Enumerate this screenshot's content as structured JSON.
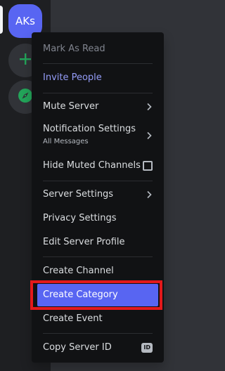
{
  "server_rail": {
    "server_initials": "AKs"
  },
  "context_menu": {
    "mark_as_read": "Mark As Read",
    "invite_people": "Invite People",
    "mute_server": "Mute Server",
    "notification_settings": "Notification Settings",
    "notification_settings_sub": "All Messages",
    "hide_muted_channels": "Hide Muted Channels",
    "server_settings": "Server Settings",
    "privacy_settings": "Privacy Settings",
    "edit_server_profile": "Edit Server Profile",
    "create_channel": "Create Channel",
    "create_category": "Create Category",
    "create_event": "Create Event",
    "copy_server_id": "Copy Server ID",
    "id_badge": "ID"
  },
  "icons": {
    "add_server": "plus-icon",
    "explore": "compass-icon",
    "submenu": "chevron-right-icon",
    "checkbox": "checkbox-icon",
    "id": "id-icon"
  },
  "colors": {
    "rail_background": "#1e1f22",
    "menu_background": "#111214",
    "brand": "#5865f2",
    "brand_text": "#949cf7",
    "green": "#23a55a",
    "annotation_red": "#e3191b"
  },
  "annotation": {
    "highlighted_item": "Create Category"
  }
}
